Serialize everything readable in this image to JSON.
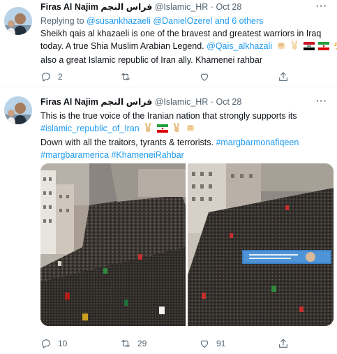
{
  "tweets": [
    {
      "author_name": "Firas Al Najim",
      "author_arabic": "فراس النجم",
      "handle": "@Islamic_HR",
      "separator": "·",
      "date": "Oct 28",
      "more_label": "···",
      "replying_prefix": "Replying to",
      "replying_user1": "@susankhazaeli",
      "replying_user2": "@DanielOzerel",
      "replying_suffix": "and 6 others",
      "line1": "Sheikh qais al khazaeli is one of the bravest and greatest warriors in Iraq",
      "line2_text": "today. A true Shia Muslim Arabian Legend.",
      "line2_mention": "@Qais_alkhazali",
      "line3": "also a great Islamic republic of Iran ally. Khamenei rahbar",
      "reply_count": "2",
      "retweet_count": "",
      "like_count": ""
    },
    {
      "author_name": "Firas Al Najim",
      "author_arabic": "فراس النجم",
      "handle": "@Islamic_HR",
      "separator": "·",
      "date": "Oct 28",
      "more_label": "···",
      "line1": "This is the true voice of the Iranian nation that strongly supports its",
      "hashtag_iran": "#islamic_republic_of_Iran",
      "line3_text": "Down with all the traitors, tyrants & terrorists.",
      "hashtag_monafiqeen": "#margbarmonafiqeen",
      "hashtag_america": "#margbaramerica",
      "hashtag_khamenei": "#KhameneiRahbar",
      "banner_text": "",
      "reply_count": "10",
      "retweet_count": "29",
      "like_count": "91"
    }
  ],
  "icons": {
    "reply": "reply-icon",
    "retweet": "retweet-icon",
    "like": "heart-icon",
    "share": "share-icon"
  },
  "colors": {
    "link": "#1d9bf0",
    "muted": "#536471",
    "text": "#0f1419",
    "divider": "#eff3f4"
  }
}
